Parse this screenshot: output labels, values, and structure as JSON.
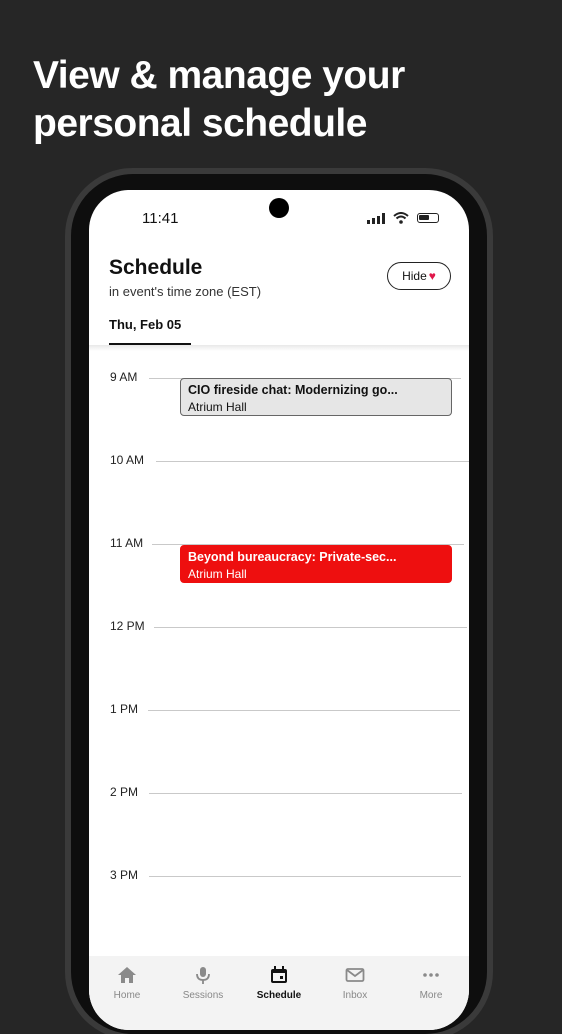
{
  "promo": {
    "headline_line1": "View & manage your",
    "headline_line2": "personal schedule"
  },
  "status_bar": {
    "time": "11:41"
  },
  "header": {
    "title": "Schedule",
    "subtitle": "in event's time zone (EST)",
    "hide_label": "Hide",
    "selected_date": "Thu, Feb 05"
  },
  "timeline": {
    "hours": [
      "9 AM",
      "10 AM",
      "11 AM",
      "12 PM",
      "1 PM",
      "2 PM",
      "3 PM"
    ]
  },
  "events": [
    {
      "title": "CIO fireside chat: Modernizing go...",
      "room": "Atrium Hall",
      "style": "saved"
    },
    {
      "title": "Beyond bureaucracy: Private-sec...",
      "room": "Atrium Hall",
      "style": "highlighted"
    }
  ],
  "nav": {
    "items": [
      {
        "label": "Home",
        "icon": "home-icon"
      },
      {
        "label": "Sessions",
        "icon": "microphone-icon"
      },
      {
        "label": "Schedule",
        "icon": "calendar-icon",
        "active": true
      },
      {
        "label": "Inbox",
        "icon": "envelope-icon"
      },
      {
        "label": "More",
        "icon": "more-dots-icon"
      }
    ]
  },
  "colors": {
    "background": "#262626",
    "accent_red": "#ee0f0f",
    "heart": "#e0174a"
  }
}
